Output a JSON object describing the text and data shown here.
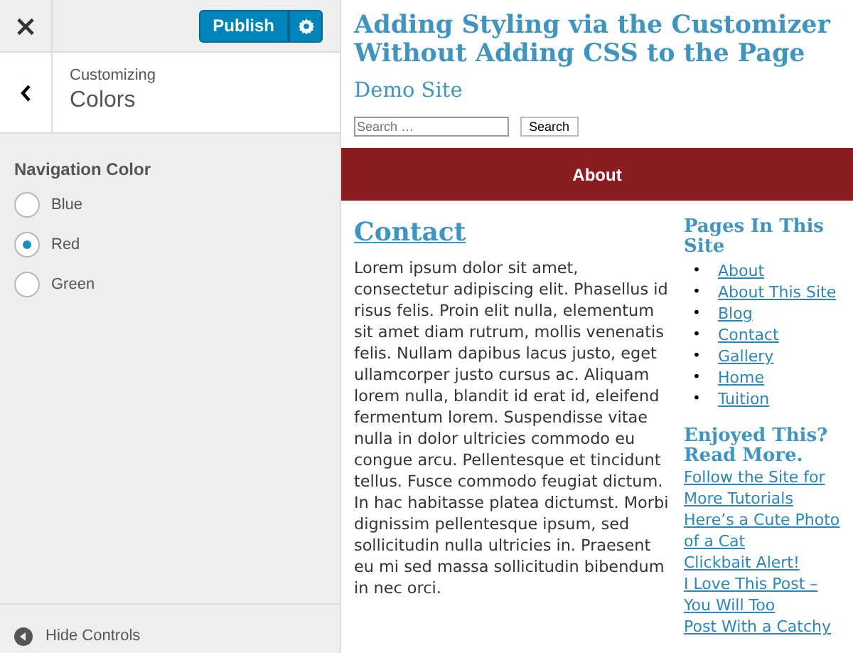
{
  "customizer": {
    "close_icon": "×",
    "publish_button": "Publish",
    "breadcrumb": "Customizing",
    "section_title": "Colors",
    "control_label": "Navigation Color",
    "options": [
      {
        "label": "Blue",
        "selected": false
      },
      {
        "label": "Red",
        "selected": true
      },
      {
        "label": "Green",
        "selected": false
      }
    ],
    "hide_controls": "Hide Controls"
  },
  "preview": {
    "site_title": "Adding Styling via the Customizer Without Adding CSS to the Page",
    "site_description": "Demo Site",
    "search": {
      "placeholder": "Search …",
      "button": "Search"
    },
    "nav_items": [
      "About"
    ],
    "post_title": "Contact",
    "post_body": "Lorem ipsum dolor sit amet, consectetur adipiscing elit. Phasellus id risus felis. Proin elit nulla, elementum sit amet diam rutrum, mollis venenatis felis. Nullam dapibus lacus justo, eget ullamcorper justo cursus ac. Aliquam lorem nulla, blandit id erat id, eleifend fermentum lorem. Suspendisse vitae nulla in dolor ultricies commodo eu congue arcu. Pellentesque et tincidunt tellus. Fusce commodo feugiat dictum. In hac habitasse platea dictumst. Morbi dignissim pellentesque ipsum, sed sollicitudin nulla ultricies in. Praesent eu mi sed massa sollicitudin bibendum in nec orci.",
    "pages_heading": "Pages In This Site",
    "pages": [
      {
        "bullet": "•",
        "label": "About"
      },
      {
        "bullet": "•",
        "label": "About This Site"
      },
      {
        "bullet": "•",
        "label": "Blog"
      },
      {
        "bullet": "•",
        "label": "Contact"
      },
      {
        "bullet": "•",
        "label": "Gallery"
      },
      {
        "bullet": "•",
        "label": "Home"
      },
      {
        "bullet": "•",
        "label": "Tuition"
      }
    ],
    "more_heading": "Enjoyed This? Read More.",
    "more_links": [
      "Follow the Site for More Tutorials",
      "Here’s a Cute Photo of a Cat",
      "Clickbait Alert!",
      "I Love This Post – You Will Too",
      "Post With a Catchy"
    ]
  }
}
